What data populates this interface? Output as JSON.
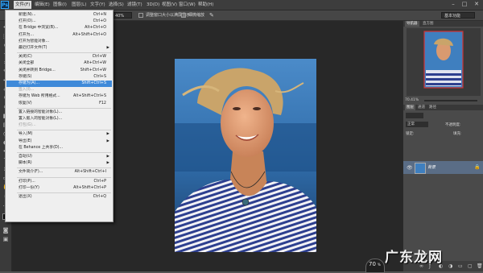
{
  "menubar": {
    "items": [
      "文件(F)",
      "编辑(E)",
      "图像(I)",
      "图层(L)",
      "文字(Y)",
      "选择(S)",
      "滤镜(T)",
      "3D(D)",
      "视图(V)",
      "窗口(W)",
      "帮助(H)"
    ]
  },
  "options": {
    "zoom": "40%",
    "fit_all_windows": "调整窗口大小以满屏显示",
    "scrubby_zoom": "细微缩放",
    "workspace": "基本功能"
  },
  "panels": {
    "top_tabs": [
      "导航器",
      "直方图"
    ],
    "zoom_value": "70.41%",
    "layers_tabs": [
      "图层",
      "通道",
      "路径"
    ],
    "layer_name": "背景",
    "blend_mode": "正常",
    "opacity_label": "不透明度:",
    "fill_label": "填充:",
    "lock_label": "锁定:"
  },
  "file_menu": {
    "items": [
      {
        "label": "新建(N)...",
        "shortcut": "Ctrl+N"
      },
      {
        "label": "打开(O)...",
        "shortcut": "Ctrl+O"
      },
      {
        "label": "在 Bridge 中浏览(B)...",
        "shortcut": "Alt+Ctrl+O"
      },
      {
        "label": "打开为...",
        "shortcut": "Alt+Shift+Ctrl+O"
      },
      {
        "label": "打开为智能对象...",
        "shortcut": ""
      },
      {
        "label": "最近打开文件(T)",
        "shortcut": "",
        "submenu": true
      },
      {
        "sep": true
      },
      {
        "label": "关闭(C)",
        "shortcut": "Ctrl+W"
      },
      {
        "label": "关闭全部",
        "shortcut": "Alt+Ctrl+W"
      },
      {
        "label": "关闭并转到 Bridge...",
        "shortcut": "Shift+Ctrl+W"
      },
      {
        "label": "存储(S)",
        "shortcut": "Ctrl+S"
      },
      {
        "label": "存储为(A)...",
        "shortcut": "Shift+Ctrl+S",
        "highlight": true
      },
      {
        "label": "签入(I)...",
        "shortcut": "",
        "disabled": true
      },
      {
        "label": "存储为 Web 所用格式...",
        "shortcut": "Alt+Shift+Ctrl+S"
      },
      {
        "label": "恢复(V)",
        "shortcut": "F12"
      },
      {
        "sep": true
      },
      {
        "label": "置入链接的智能对象(L)...",
        "shortcut": ""
      },
      {
        "label": "置入嵌入的智能对象(L)...",
        "shortcut": ""
      },
      {
        "label": "打包(G)...",
        "shortcut": "",
        "disabled": true
      },
      {
        "sep": true
      },
      {
        "label": "导入(M)",
        "shortcut": "",
        "submenu": true
      },
      {
        "label": "导出(E)",
        "shortcut": "",
        "submenu": true
      },
      {
        "label": "在 Behance 上共享(D)...",
        "shortcut": ""
      },
      {
        "sep": true
      },
      {
        "label": "自动(U)",
        "shortcut": "",
        "submenu": true
      },
      {
        "label": "脚本(R)",
        "shortcut": "",
        "submenu": true
      },
      {
        "sep": true
      },
      {
        "label": "文件简介(F)...",
        "shortcut": "Alt+Shift+Ctrl+I"
      },
      {
        "sep": true
      },
      {
        "label": "打印(P)...",
        "shortcut": "Ctrl+P"
      },
      {
        "label": "打印一份(Y)",
        "shortcut": "Alt+Shift+Ctrl+P"
      },
      {
        "sep": true
      },
      {
        "label": "退出(X)",
        "shortcut": "Ctrl+Q"
      }
    ]
  },
  "status": {
    "gauge_value": "70",
    "gauge_unit": "%"
  },
  "watermark": "广东龙网",
  "colors": {
    "highlight": "#3f8ad9",
    "ps_blue": "#31a8ff"
  }
}
